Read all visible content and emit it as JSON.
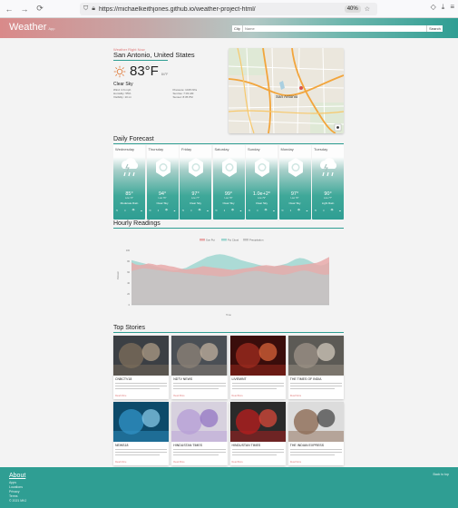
{
  "browser": {
    "url": "https://michaelkeithjones.github.io/weather-project-html/",
    "zoom": "40%"
  },
  "header": {
    "brand": "Weather",
    "brand_small": "App",
    "search_label": "City",
    "search_placeholder": "Name",
    "search_button": "Search"
  },
  "current": {
    "label": "Weather Right Now",
    "city": "San Antonio, United States",
    "temp": "83°F",
    "feels": "84°F",
    "condition": "Clear Sky",
    "details_left": [
      "Wind: 4.6 mph",
      "Humidity: 55%",
      "Visibility: 10 mi"
    ],
    "details_right": [
      "Pressure: 1015 hPa",
      "Sunrise: 7:03 AM",
      "Sunset: 8:35 PM"
    ]
  },
  "map": {
    "city_label": "San Antonio"
  },
  "daily": {
    "title": "Daily Forecast",
    "days": [
      {
        "name": "Wednesday",
        "temp": "85°",
        "sub": "Low 74°",
        "cond": "Moderate Rain",
        "icon": "rain"
      },
      {
        "name": "Thursday",
        "temp": "94°",
        "sub": "Low 76°",
        "cond": "Clear Sky",
        "icon": "sun"
      },
      {
        "name": "Friday",
        "temp": "97°",
        "sub": "Low 77°",
        "cond": "Clear Sky",
        "icon": "sun"
      },
      {
        "name": "Saturday",
        "temp": "99°",
        "sub": "Low 78°",
        "cond": "Clear Sky",
        "icon": "sun"
      },
      {
        "name": "Sunday",
        "temp": "1.0e+2°",
        "sub": "Low 79°",
        "cond": "Clear Sky",
        "icon": "sun"
      },
      {
        "name": "Monday",
        "temp": "97°",
        "sub": "Low 78°",
        "cond": "Clear Sky",
        "icon": "sun"
      },
      {
        "name": "Tuesday",
        "temp": "90°",
        "sub": "Low 77°",
        "cond": "Light Rain",
        "icon": "rain"
      }
    ]
  },
  "hourly": {
    "title": "Hourly Readings"
  },
  "chart_data": {
    "type": "area",
    "title": "",
    "xlabel": "Time",
    "ylabel": "Percent",
    "ylim": [
      0,
      100
    ],
    "legend_position": "top",
    "series": [
      {
        "name": "Sun Pct",
        "color": "#e8a9a9",
        "values": [
          78,
          74,
          73,
          74,
          76,
          75,
          73,
          74,
          73,
          71,
          70,
          68,
          66,
          65,
          66,
          67,
          69,
          71,
          70,
          69,
          68,
          67,
          66,
          65,
          64,
          65,
          66,
          67,
          68,
          69,
          71,
          72,
          73,
          72,
          71,
          72,
          73,
          72,
          71,
          72,
          73,
          74,
          75,
          76,
          77,
          80,
          84,
          88
        ]
      },
      {
        "name": "Pct Cloud",
        "color": "#9fd6d0",
        "values": [
          82,
          80,
          78,
          76,
          74,
          72,
          70,
          68,
          66,
          64,
          63,
          64,
          66,
          68,
          72,
          76,
          80,
          84,
          88,
          90,
          92,
          93,
          92,
          90,
          88,
          85,
          82,
          80,
          78,
          76,
          74,
          72,
          71,
          70,
          70,
          72,
          74,
          76,
          80,
          84,
          86,
          85,
          82,
          78,
          74,
          72,
          74,
          78
        ]
      },
      {
        "name": "Precipitation",
        "color": "#c4c4c4",
        "values": [
          62,
          64,
          66,
          67,
          66,
          65,
          64,
          63,
          62,
          61,
          60,
          60,
          59,
          58,
          57,
          56,
          56,
          55,
          54,
          54,
          53,
          52,
          52,
          53,
          54,
          56,
          58,
          60,
          61,
          62,
          62,
          61,
          60,
          58,
          57,
          56,
          55,
          56,
          58,
          60,
          62,
          63,
          62,
          60,
          58,
          56,
          55,
          56
        ]
      }
    ]
  },
  "stories": {
    "title": "Top Stories",
    "items": [
      {
        "source": "CNBCTV18",
        "link": "Read More",
        "img": "img1"
      },
      {
        "source": "NDTV NEWS",
        "link": "Read More",
        "img": "img2"
      },
      {
        "source": "LIVEMINT",
        "link": "Read More",
        "img": "img3"
      },
      {
        "source": "THE TIMES OF INDIA",
        "link": "Read More",
        "img": "img4"
      },
      {
        "source": "NEWS18",
        "link": "Read More",
        "img": "img5"
      },
      {
        "source": "HINDUSTAN TIMES",
        "link": "Read More",
        "img": "img6"
      },
      {
        "source": "HINDUSTAN TIMES",
        "link": "Read More",
        "img": "img7"
      },
      {
        "source": "THE INDIAN EXPRESS",
        "link": "Read More",
        "img": "img8"
      }
    ]
  },
  "footer": {
    "title": "About",
    "links": [
      "Apps",
      "Locations",
      "Privacy",
      "Terms",
      "© 2021 MKJ"
    ],
    "right": "Back to top"
  }
}
